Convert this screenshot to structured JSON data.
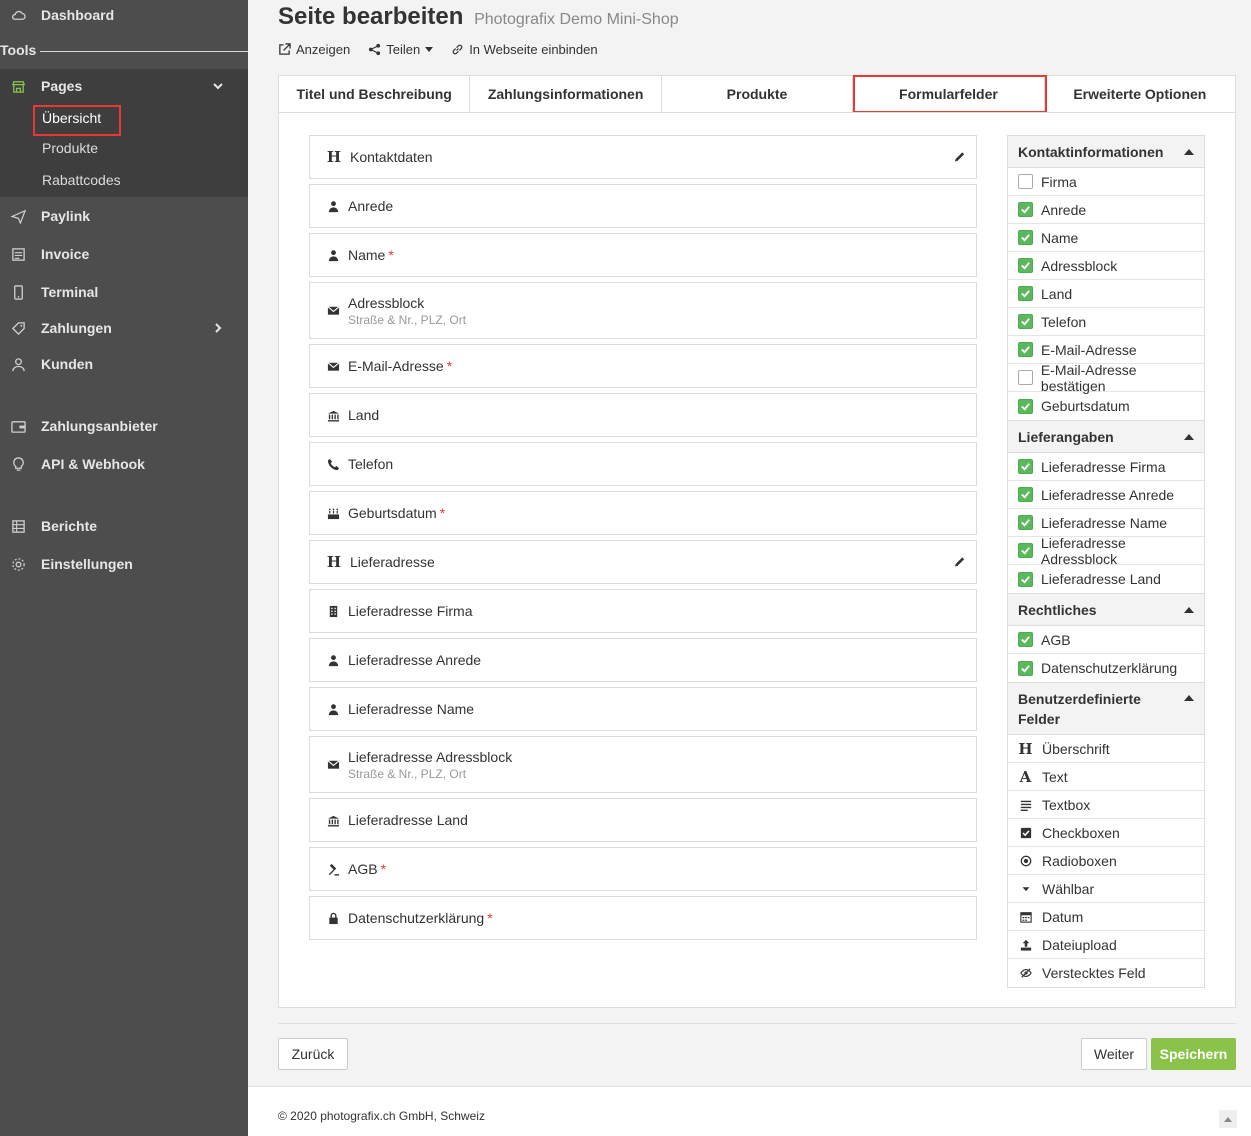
{
  "sidebar": {
    "dashboard": "Dashboard",
    "tools": "Tools",
    "pages": "Pages",
    "pages_sub": [
      "Übersicht",
      "Produkte",
      "Rabattcodes"
    ],
    "items": [
      "Paylink",
      "Invoice",
      "Terminal",
      "Zahlungen",
      "Kunden",
      "Zahlungsanbieter",
      "API & Webhook",
      "Berichte",
      "Einstellungen"
    ]
  },
  "header": {
    "title": "Seite bearbeiten",
    "subtitle": "Photografix Demo Mini-Shop",
    "actions": [
      "Anzeigen",
      "Teilen",
      "In Webseite einbinden"
    ]
  },
  "tabs": [
    "Titel und Beschreibung",
    "Zahlungsinformationen",
    "Produkte",
    "Formularfelder",
    "Erweiterte Optionen"
  ],
  "fields": [
    {
      "label": "Kontaktdaten",
      "icon": "heading-icon",
      "required": false,
      "sub": ""
    },
    {
      "label": "Anrede",
      "icon": "user-icon",
      "required": false,
      "sub": ""
    },
    {
      "label": "Name",
      "icon": "user-icon",
      "required": true,
      "sub": ""
    },
    {
      "label": "Adressblock",
      "icon": "envelope-icon",
      "required": false,
      "sub": "Straße & Nr., PLZ, Ort"
    },
    {
      "label": "E-Mail-Adresse",
      "icon": "envelope-icon",
      "required": true,
      "sub": ""
    },
    {
      "label": "Land",
      "icon": "bank-icon",
      "required": false,
      "sub": ""
    },
    {
      "label": "Telefon",
      "icon": "phone-icon",
      "required": false,
      "sub": ""
    },
    {
      "label": "Geburtsdatum",
      "icon": "cake-icon",
      "required": true,
      "sub": ""
    },
    {
      "label": "Lieferadresse",
      "icon": "heading-icon",
      "required": false,
      "sub": ""
    },
    {
      "label": "Lieferadresse Firma",
      "icon": "building-icon",
      "required": false,
      "sub": ""
    },
    {
      "label": "Lieferadresse Anrede",
      "icon": "user-icon",
      "required": false,
      "sub": ""
    },
    {
      "label": "Lieferadresse Name",
      "icon": "user-icon",
      "required": false,
      "sub": ""
    },
    {
      "label": "Lieferadresse Adressblock",
      "icon": "envelope-icon",
      "required": false,
      "sub": "Straße & Nr., PLZ, Ort"
    },
    {
      "label": "Lieferadresse Land",
      "icon": "bank-icon",
      "required": false,
      "sub": ""
    },
    {
      "label": "AGB",
      "icon": "gavel-icon",
      "required": true,
      "sub": ""
    },
    {
      "label": "Datenschutzerklärung",
      "icon": "lock-icon",
      "required": true,
      "sub": ""
    }
  ],
  "right_panel": {
    "kontakt": {
      "title": "Kontaktinformationen",
      "items": [
        {
          "label": "Firma",
          "checked": false
        },
        {
          "label": "Anrede",
          "checked": true
        },
        {
          "label": "Name",
          "checked": true
        },
        {
          "label": "Adressblock",
          "checked": true
        },
        {
          "label": "Land",
          "checked": true
        },
        {
          "label": "Telefon",
          "checked": true
        },
        {
          "label": "E-Mail-Adresse",
          "checked": true
        },
        {
          "label": "E-Mail-Adresse bestätigen",
          "checked": false
        },
        {
          "label": "Geburtsdatum",
          "checked": true
        }
      ]
    },
    "liefer": {
      "title": "Lieferangaben",
      "items": [
        {
          "label": "Lieferadresse Firma",
          "checked": true
        },
        {
          "label": "Lieferadresse Anrede",
          "checked": true
        },
        {
          "label": "Lieferadresse Name",
          "checked": true
        },
        {
          "label": "Lieferadresse Adressblock",
          "checked": true
        },
        {
          "label": "Lieferadresse Land",
          "checked": true
        }
      ]
    },
    "recht": {
      "title": "Rechtliches",
      "items": [
        {
          "label": "AGB",
          "checked": true
        },
        {
          "label": "Datenschutzerklärung",
          "checked": true
        }
      ]
    },
    "custom": {
      "title_line1": "Benutzerdefinierte",
      "title_line2": "Felder",
      "items": [
        {
          "label": "Überschrift",
          "icon": "heading-icon"
        },
        {
          "label": "Text",
          "icon": "font-icon"
        },
        {
          "label": "Textbox",
          "icon": "align-justify-icon"
        },
        {
          "label": "Checkboxen",
          "icon": "checkbox-icon"
        },
        {
          "label": "Radioboxen",
          "icon": "radio-icon"
        },
        {
          "label": "Wählbar",
          "icon": "caret-down-icon"
        },
        {
          "label": "Datum",
          "icon": "calendar-icon"
        },
        {
          "label": "Dateiupload",
          "icon": "upload-icon"
        },
        {
          "label": "Verstecktes Feld",
          "icon": "eye-slash-icon"
        }
      ]
    }
  },
  "buttons": {
    "back": "Zurück",
    "next": "Weiter",
    "save": "Speichern"
  },
  "footer": {
    "text": "© 2020 photografix.ch GmbH, Schweiz"
  },
  "colors": {
    "sidebar": "#4d4d4d",
    "accent": "#8bc34a",
    "highlight": "#e53935",
    "check": "#5cb85c"
  }
}
